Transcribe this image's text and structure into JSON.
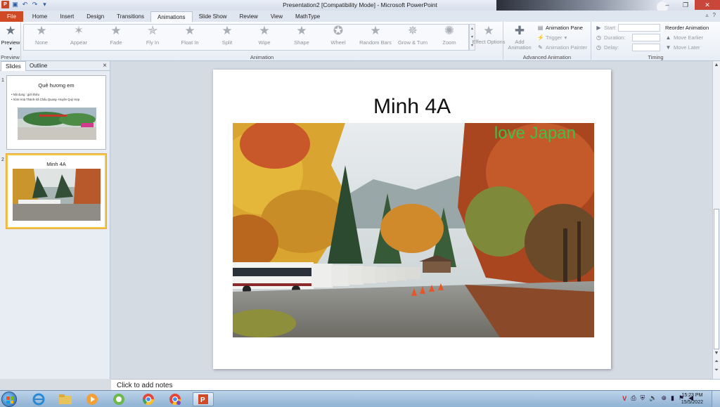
{
  "window": {
    "title": "Presentation2 [Compatibility Mode]  -  Microsoft PowerPoint",
    "controls": [
      "minimize",
      "restore",
      "close"
    ]
  },
  "quick_access": {
    "icons": [
      "powerpoint-logo",
      "save-icon",
      "undo-icon",
      "redo-icon",
      "customize-icon"
    ]
  },
  "tabs": [
    {
      "label": "File"
    },
    {
      "label": "Home"
    },
    {
      "label": "Insert"
    },
    {
      "label": "Design"
    },
    {
      "label": "Transitions"
    },
    {
      "label": "Animations",
      "active": true
    },
    {
      "label": "Slide Show"
    },
    {
      "label": "Review"
    },
    {
      "label": "View"
    },
    {
      "label": "MathType"
    }
  ],
  "ribbon": {
    "preview": {
      "button": "Preview",
      "group": "Preview"
    },
    "animation_group": "Animation",
    "animations": [
      "None",
      "Appear",
      "Fade",
      "Fly In",
      "Float In",
      "Split",
      "Wipe",
      "Shape",
      "Wheel",
      "Random Bars",
      "Grow & Turn",
      "Zoom"
    ],
    "effect_options": "Effect Options",
    "add_animation": "Add Animation",
    "animation_pane": "Animation Pane",
    "trigger": "Trigger",
    "animation_painter": "Animation Painter",
    "advanced_group": "Advanced Animation",
    "start_label": "Start:",
    "duration_label": "Duration:",
    "delay_label": "Delay:",
    "reorder_label": "Reorder Animation",
    "move_earlier": "Move Earlier",
    "move_later": "Move Later",
    "timing_group": "Timing"
  },
  "slides_pane": {
    "tab_slides": "Slides",
    "tab_outline": "Outline",
    "close": "×",
    "slides": [
      {
        "number": "1",
        "title": "Quê hương em",
        "bullets": [
          "Nội dung : giới thiệu",
          "Xóm Hoà Thành-Xã Châu Quang- Huyện Quỳ Hợp"
        ]
      },
      {
        "number": "2",
        "title": "Minh 4A"
      }
    ]
  },
  "slide": {
    "title": "Minh 4A",
    "photo_caption": "love Japan"
  },
  "notes": {
    "placeholder": "Click to add notes"
  },
  "taskbar": {
    "apps": [
      "start-button",
      "internet-explorer",
      "file-explorer",
      "media-player",
      "game-app",
      "chrome",
      "chrome-profile",
      "powerpoint"
    ],
    "tray_icons": [
      "antivirus-icon",
      "printer-icon",
      "shield-icon",
      "volume-icon",
      "network-icon",
      "signal-icon",
      "flag-icon",
      "speaker-icon"
    ],
    "time": "15:23 PM",
    "date": "15/5/2022"
  }
}
